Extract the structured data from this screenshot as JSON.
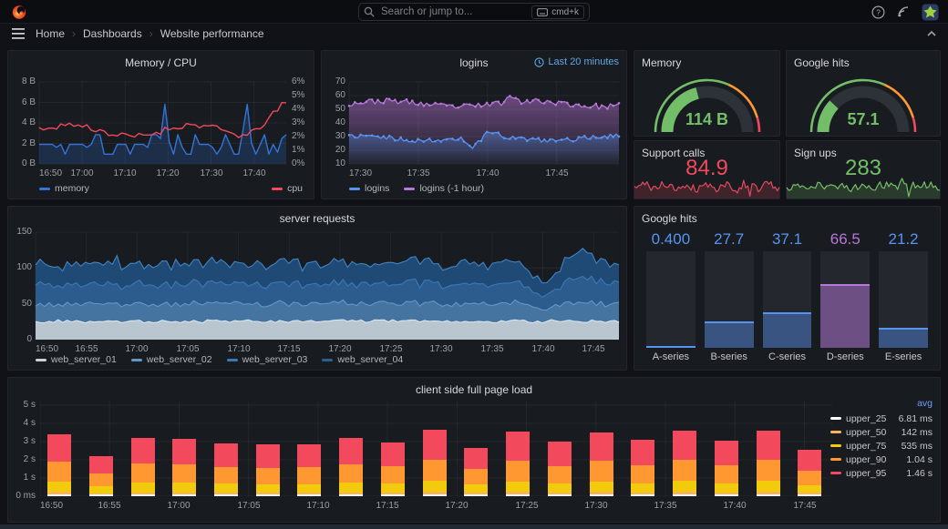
{
  "nav": {
    "search_placeholder": "Search or jump to...",
    "search_shortcut": "cmd+k",
    "breadcrumb": [
      "Home",
      "Dashboards",
      "Website performance"
    ]
  },
  "colors": {
    "blue": "#5794f2",
    "dark_blue": "#3274d9",
    "red": "#f2495c",
    "purple": "#b877d9",
    "green": "#73bf69",
    "orange": "#ff9830",
    "yellow": "#f2cc0c",
    "light_orange": "#ffb357",
    "white": "#ffffff",
    "link_blue": "#6e9fff"
  },
  "panels": {
    "memory_cpu": {
      "title": "Memory / CPU",
      "y_left": [
        "8 B",
        "6 B",
        "4 B",
        "2 B",
        "0 B"
      ],
      "y_right": [
        "6%",
        "5%",
        "4%",
        "3%",
        "2%",
        "1%",
        "0%"
      ],
      "x_ticks": [
        "16:50",
        "17:00",
        "17:10",
        "17:20",
        "17:30",
        "17:40"
      ],
      "legend_left": {
        "label": "memory",
        "color": "#3274d9"
      },
      "legend_right": {
        "label": "cpu",
        "color": "#f2495c"
      }
    },
    "logins": {
      "title": "logins",
      "time_range": "Last 20 minutes",
      "y_ticks": [
        "70",
        "60",
        "50",
        "40",
        "30",
        "20",
        "10"
      ],
      "x_ticks": [
        "17:30",
        "17:35",
        "17:40",
        "17:45"
      ],
      "legend": [
        {
          "label": "logins",
          "color": "#5794f2"
        },
        {
          "label": "logins (-1 hour)",
          "color": "#b877d9"
        }
      ]
    },
    "memory_gauge": {
      "title": "Memory",
      "value": "114 B",
      "percent": 42,
      "color": "#73bf69"
    },
    "google_hits_gauge": {
      "title": "Google hits",
      "value": "57.1",
      "percent": 24,
      "color": "#73bf69"
    },
    "support_calls": {
      "title": "Support calls",
      "value": "84.9",
      "color": "#f2495c"
    },
    "sign_ups": {
      "title": "Sign ups",
      "value": "283",
      "color": "#73bf69"
    },
    "server_requests": {
      "title": "server requests",
      "y_ticks": [
        "150",
        "100",
        "50",
        "0"
      ],
      "x_ticks": [
        "16:50",
        "16:55",
        "17:00",
        "17:05",
        "17:10",
        "17:15",
        "17:20",
        "17:25",
        "17:30",
        "17:35",
        "17:40",
        "17:45"
      ],
      "legend": [
        {
          "label": "web_server_01",
          "color": "#c6d3dd"
        },
        {
          "label": "web_server_02",
          "color": "#6198c8"
        },
        {
          "label": "web_server_03",
          "color": "#3c78b4"
        },
        {
          "label": "web_server_04",
          "color": "#2a5f93"
        }
      ]
    },
    "google_hits_bars": {
      "title": "Google hits",
      "max": 100,
      "bars": [
        {
          "label": "A-series",
          "value": "0.400",
          "num": 0.4,
          "color": "#5794f2"
        },
        {
          "label": "B-series",
          "value": "27.7",
          "num": 27.7,
          "color": "#5794f2"
        },
        {
          "label": "C-series",
          "value": "37.1",
          "num": 37.1,
          "color": "#5794f2"
        },
        {
          "label": "D-series",
          "value": "66.5",
          "num": 66.5,
          "color": "#b877d9"
        },
        {
          "label": "E-series",
          "value": "21.2",
          "num": 21.2,
          "color": "#5794f2"
        }
      ]
    },
    "page_load": {
      "title": "client side full page load",
      "y_ticks": [
        "5 s",
        "4 s",
        "3 s",
        "2 s",
        "1 s",
        "0 ms"
      ],
      "x_ticks": [
        "16:50",
        "16:55",
        "17:00",
        "17:05",
        "17:10",
        "17:15",
        "17:20",
        "17:25",
        "17:30",
        "17:35",
        "17:40",
        "17:45"
      ],
      "legend_header": "avg",
      "legend": [
        {
          "label": "upper_25",
          "avg": "6.81 ms",
          "color": "#ffffff"
        },
        {
          "label": "upper_50",
          "avg": "142 ms",
          "color": "#ffb357"
        },
        {
          "label": "upper_75",
          "avg": "535 ms",
          "color": "#f2cc0c"
        },
        {
          "label": "upper_90",
          "avg": "1.04 s",
          "color": "#ff9830"
        },
        {
          "label": "upper_95",
          "avg": "1.46 s",
          "color": "#f2495c"
        }
      ],
      "bar_totals": [
        3.35,
        2.15,
        3.15,
        3.08,
        2.85,
        2.76,
        2.78,
        3.12,
        2.9,
        3.6,
        2.6,
        3.5,
        2.92,
        3.42,
        3.05,
        3.52,
        3.0,
        3.55,
        2.48
      ],
      "segment_fractions": [
        0.002,
        0.045,
        0.168,
        0.327,
        0.458
      ]
    }
  }
}
